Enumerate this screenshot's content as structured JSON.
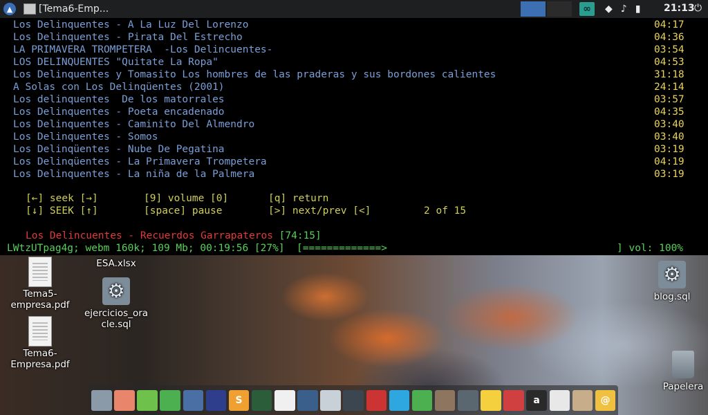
{
  "panel": {
    "app_menu_label": "",
    "window_title": "[Tema6-Emp...",
    "clock": "21:13",
    "workspaces": [
      {
        "color": "#3d6fb3"
      },
      {
        "color": "#2b2b2b"
      }
    ],
    "tray_icons": [
      "wifi-icon",
      "volume-icon",
      "battery-icon"
    ],
    "power_icon": "power-icon"
  },
  "terminal": {
    "playlist": [
      {
        "title": "Los Delinquentes - A La Luz Del Lorenzo",
        "time": "04:17"
      },
      {
        "title": "Los Delinquentes - Pirata Del Estrecho",
        "time": "04:36"
      },
      {
        "title": "LA PRIMAVERA TROMPETERA  -Los Delincuentes-",
        "time": "03:54"
      },
      {
        "title": "LOS DELINQUENTES \"Quitate La Ropa\"",
        "time": "04:53"
      },
      {
        "title": "Los Delinquentes y Tomasito Los hombres de las praderas y sus bordones calientes",
        "time": "31:18"
      },
      {
        "title": "A Solas con Los Delinqüentes (2001)",
        "time": "24:14"
      },
      {
        "title": "Los delinquentes  De los matorrales",
        "time": "03:57"
      },
      {
        "title": "Los Delinquentes - Poeta encadenado",
        "time": "04:35"
      },
      {
        "title": "Los Delinquentes - Caminito Del Almendro",
        "time": "03:40"
      },
      {
        "title": "Los Delinquentes - Somos",
        "time": "03:40"
      },
      {
        "title": "Los Delinqüentes - Nube De Pegatina",
        "time": "03:19"
      },
      {
        "title": "Los Delinqüentes - La Primavera Trompetera",
        "time": "04:19"
      },
      {
        "title": "Los Delinquentes - La niña de la Palmera",
        "time": "03:19"
      }
    ],
    "help": {
      "seek": "[←] seek [→]",
      "seek_big": "[↓] SEEK [↑]",
      "volume": "[9] volume [0]",
      "pause": "[space] pause",
      "return": "[q] return",
      "nextprev": "[>] next/prev [<]",
      "position": "2 of 15"
    },
    "now_playing": {
      "title": "Los Delincuentes - Recuerdos Garrapateros",
      "duration": "[74:15]"
    },
    "status_line": "LWtzUTpag4g; webm 160k; 109 Mb; 00:19:56 [27%]  [=============>",
    "volume": "] vol: 100%"
  },
  "desktop": {
    "icons": [
      {
        "label": "Tema5-\nempresa.pdf",
        "kind": "doc"
      },
      {
        "label": "ESA.xlsx",
        "kind": "none"
      },
      {
        "label": "ejercicios_ora\ncle.sql",
        "kind": "gear"
      },
      {
        "label": "Tema6-\nEmpresa.pdf",
        "kind": "doc"
      },
      {
        "label": "blog.sql",
        "kind": "gear"
      },
      {
        "label": "Papelera",
        "kind": "trash"
      }
    ]
  },
  "dock": {
    "items": [
      {
        "name": "files-icon",
        "color": "#8a9aa8",
        "glyph": ""
      },
      {
        "name": "image-viewer-icon",
        "color": "#e9856a",
        "glyph": ""
      },
      {
        "name": "leaf-icon",
        "color": "#6ec24b",
        "glyph": ""
      },
      {
        "name": "browser-icon",
        "color": "#4caf50",
        "glyph": ""
      },
      {
        "name": "network-icon",
        "color": "#4a6fa5",
        "glyph": ""
      },
      {
        "name": "java-icon",
        "color": "#2e3e8c",
        "glyph": ""
      },
      {
        "name": "sublime-icon",
        "color": "#f0a030",
        "glyph": "S"
      },
      {
        "name": "monitor-icon",
        "color": "#2b5d3a",
        "glyph": ""
      },
      {
        "name": "document-icon",
        "color": "#f0f0f0",
        "glyph": ""
      },
      {
        "name": "mysql-workbench-icon",
        "color": "#3a5f8a",
        "glyph": ""
      },
      {
        "name": "folder-icon",
        "color": "#c8d0d8",
        "glyph": ""
      },
      {
        "name": "terminal-icon",
        "color": "#3c4650",
        "glyph": ""
      },
      {
        "name": "archive-icon",
        "color": "#cc3333",
        "glyph": ""
      },
      {
        "name": "telegram-icon",
        "color": "#2ea6e0",
        "glyph": ""
      },
      {
        "name": "spreadsheet-icon",
        "color": "#4caf50",
        "glyph": ""
      },
      {
        "name": "deb-package-icon",
        "color": "#8d7560",
        "glyph": ""
      },
      {
        "name": "calculator-icon",
        "color": "#5b6770",
        "glyph": ""
      },
      {
        "name": "sticky-notes-icon",
        "color": "#f4d03f",
        "glyph": ""
      },
      {
        "name": "pencils-icon",
        "color": "#d04040",
        "glyph": ""
      },
      {
        "name": "amazon-icon",
        "color": "#2a2a2a",
        "glyph": "a"
      },
      {
        "name": "pdf-viewer-icon",
        "color": "#e8e8e8",
        "glyph": ""
      },
      {
        "name": "box-icon",
        "color": "#c8ad8a",
        "glyph": ""
      },
      {
        "name": "mail-icon",
        "color": "#f0c040",
        "glyph": "@"
      }
    ]
  }
}
